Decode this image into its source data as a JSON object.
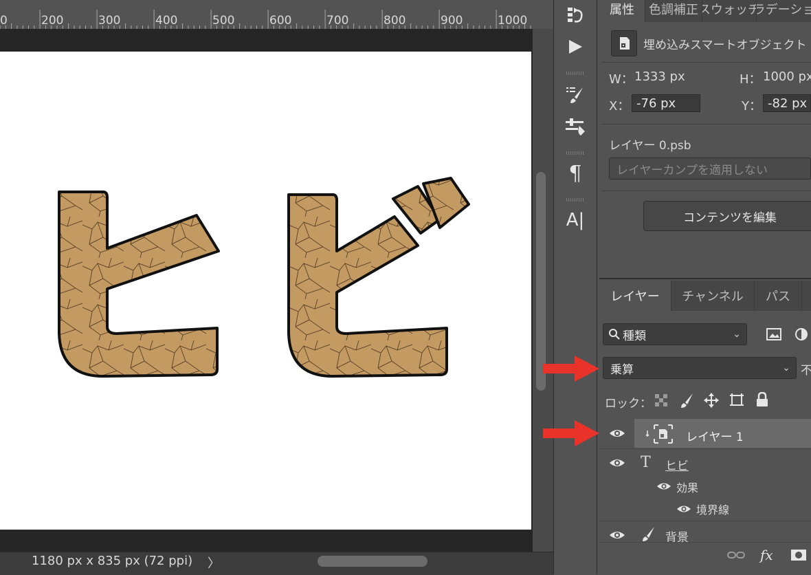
{
  "ruler": {
    "labels": [
      "0",
      "200",
      "300",
      "400",
      "500",
      "600",
      "700",
      "800",
      "900",
      "1000"
    ]
  },
  "canvas": {
    "text": "ヒビ"
  },
  "status": {
    "document_info": "1180 px x 835 px (72 ppi)",
    "arrow": "〉"
  },
  "toolstrip": {
    "tools": [
      {
        "name": "history-icon"
      },
      {
        "name": "play-action-icon"
      },
      {
        "name": "brush-settings-icon"
      },
      {
        "name": "adjustments-icon"
      },
      {
        "name": "paragraph-icon",
        "glyph": "¶"
      },
      {
        "name": "character-icon",
        "glyph": "A|"
      }
    ]
  },
  "properties": {
    "tabs": [
      "属性",
      "色調補正",
      "スウォッチ",
      "グラデーション"
    ],
    "object_type": "埋め込みスマートオブジェクト",
    "w_label": "W：",
    "w_value": "1333 px",
    "h_label": "H：",
    "h_value": "1000 px",
    "x_label": "X：",
    "x_value": "-76 px",
    "y_label": "Y：",
    "y_value": "-82 px",
    "file_name": "レイヤー 0.psb",
    "layer_comp_placeholder": "レイヤーカンプを適用しない",
    "edit_button": "コンテンツを編集"
  },
  "layers": {
    "tabs": [
      "レイヤー",
      "チャンネル",
      "パス"
    ],
    "filter_kind": "種類",
    "blend_mode": "乗算",
    "opacity_label": "不",
    "lock_label": "ロック：",
    "items": [
      {
        "name": "レイヤー 1",
        "type": "smart-object",
        "selected": true
      },
      {
        "name": "ヒビ",
        "type": "text"
      },
      {
        "name": "効果",
        "type": "effects"
      },
      {
        "name": "境界線",
        "type": "effect"
      },
      {
        "name": "背景",
        "type": "background"
      }
    ]
  },
  "colors": {
    "accent_arrow": "#e8322a",
    "selected_layer": "#6a6a6a",
    "canvas": "#ffffff",
    "letter_fill": "#c49a63"
  }
}
